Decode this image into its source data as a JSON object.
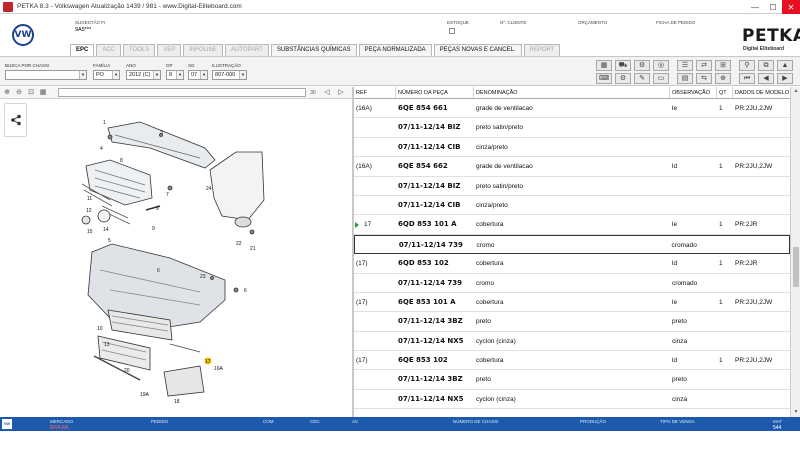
{
  "window": {
    "title": "PETKA 8.3 - Volkswagen Atualização 1439 / 981 - www.Digital-Eliteboard.com",
    "minimize": "—",
    "maximize": "☐",
    "close": "✕"
  },
  "header": {
    "logo_text": "VW",
    "sugestao_label": "SUGESTÃO FI",
    "sugestao_value": "9A5***",
    "estoque_label": "ESTOQUE",
    "cliente_label": "Nº. CLIENTE",
    "orcamento_label": "ORÇAMENTO",
    "ficha_label": "FICHA DE PEDIDO",
    "brand": "PETKA",
    "brand_sub": "Digital Eliteboard"
  },
  "tabs": [
    {
      "label": "EPC",
      "state": "active"
    },
    {
      "label": "ACC",
      "state": "disabled"
    },
    {
      "label": "TOOLS",
      "state": "disabled"
    },
    {
      "label": "VEP",
      "state": "disabled"
    },
    {
      "label": "INFOLINE",
      "state": "disabled"
    },
    {
      "label": "AUTOPART",
      "state": "disabled"
    },
    {
      "label": "SUBSTÂNCIAS QUÍMICAS",
      "state": "enabled"
    },
    {
      "label": "PEÇA NORMALIZADA",
      "state": "enabled"
    },
    {
      "label": "PEÇAS NOVAS E CANCEL.",
      "state": "enabled"
    },
    {
      "label": "REPORT",
      "state": "disabled"
    }
  ],
  "filters": {
    "chassi_label": "BUSCA POR CHASSI",
    "chassi_value": "",
    "familia_label": "FAMÍLIA",
    "familia_value": "PO",
    "ano_label": "ANO",
    "ano_value": "2012 (C)",
    "gp_label": "GP",
    "gp_value": "8",
    "sg_label": "SG",
    "sg_value": "07",
    "ilustracao_label": "ILUSTRAÇÃO",
    "ilustracao_value": "807-000"
  },
  "diagram": {
    "zoom_value": "30",
    "callouts": [
      "1",
      "2",
      "3",
      "4",
      "5",
      "6",
      "7",
      "8",
      "9",
      "10",
      "11",
      "12",
      "13",
      "14",
      "15",
      "16A",
      "17",
      "18",
      "19",
      "19A",
      "20",
      "21",
      "22",
      "23",
      "24"
    ]
  },
  "table": {
    "columns": [
      "REF",
      "NÚMERO DA PEÇA",
      "DENOMINAÇÃO",
      "OBSERVAÇÃO",
      "QT",
      "DADOS DE MODELO"
    ],
    "rows": [
      {
        "ref": "(16A)",
        "num": "6QE 854 661",
        "den": "grade de ventilacao",
        "obs": "le",
        "qt": "1",
        "dm": "PR:2JU,2JW"
      },
      {
        "ref": "",
        "num": "07/11-12/14 BIZ",
        "den": "preto satin/preto",
        "obs": "",
        "qt": "",
        "dm": ""
      },
      {
        "ref": "",
        "num": "07/11-12/14 CIB",
        "den": "cinza/preto",
        "obs": "",
        "qt": "",
        "dm": ""
      },
      {
        "ref": "(16A)",
        "num": "6QE 854 662",
        "den": "grade de ventilacao",
        "obs": "ld",
        "qt": "1",
        "dm": "PR:2JU,2JW"
      },
      {
        "ref": "",
        "num": "07/11-12/14 BIZ",
        "den": "preto satin/preto",
        "obs": "",
        "qt": "",
        "dm": ""
      },
      {
        "ref": "",
        "num": "07/11-12/14 CIB",
        "den": "cinza/preto",
        "obs": "",
        "qt": "",
        "dm": ""
      },
      {
        "ref": "17",
        "num": "6QD 853 101 A",
        "den": "cobertura",
        "obs": "le",
        "qt": "1",
        "dm": "PR:2JR",
        "marker": true
      },
      {
        "ref": "",
        "num": "07/11-12/14 739",
        "den": "cromo",
        "obs": "cromado",
        "qt": "",
        "dm": "",
        "selected": true
      },
      {
        "ref": "(17)",
        "num": "6QD 853 102",
        "den": "cobertura",
        "obs": "ld",
        "qt": "1",
        "dm": "PR:2JR"
      },
      {
        "ref": "",
        "num": "07/11-12/14 739",
        "den": "cromo",
        "obs": "cromado",
        "qt": "",
        "dm": ""
      },
      {
        "ref": "(17)",
        "num": "6QE 853 101 A",
        "den": "cobertura",
        "obs": "le",
        "qt": "1",
        "dm": "PR:2JU,2JW"
      },
      {
        "ref": "",
        "num": "07/11-12/14 3BZ",
        "den": "preto",
        "obs": "preto",
        "qt": "",
        "dm": ""
      },
      {
        "ref": "",
        "num": "07/11-12/14 NX5",
        "den": "cyclon (cinza)",
        "obs": "cinza",
        "qt": "",
        "dm": ""
      },
      {
        "ref": "(17)",
        "num": "6QE 853 102",
        "den": "cobertura",
        "obs": "ld",
        "qt": "1",
        "dm": "PR:2JU,2JW"
      },
      {
        "ref": "",
        "num": "07/11-12/14 3BZ",
        "den": "preto",
        "obs": "preto",
        "qt": "",
        "dm": ""
      },
      {
        "ref": "",
        "num": "07/11-12/14 NX5",
        "den": "cyclon (cinza)",
        "obs": "cinza",
        "qt": "",
        "dm": ""
      }
    ]
  },
  "statusbar": {
    "logo": "VW",
    "mercado_label": "MERCADO",
    "mercado_value": "BRA RA",
    "pedido_label": "PEDIDO",
    "com_label": "COM",
    "cdc_label": "CDC",
    "ac_label": "AC",
    "chassi_label": "NÚMERO DE CHASSI",
    "producao_label": "PRODUÇÃO",
    "tipo_venda_label": "TIPO DE VENDA",
    "mat_label": "MAT",
    "mat_value": "544"
  },
  "colors": {
    "statusbar_blue": "#1d5aac",
    "brand_red": "#c0272d",
    "marker_green": "#2a9d2a",
    "vw_blue": "#1b3f8c"
  }
}
